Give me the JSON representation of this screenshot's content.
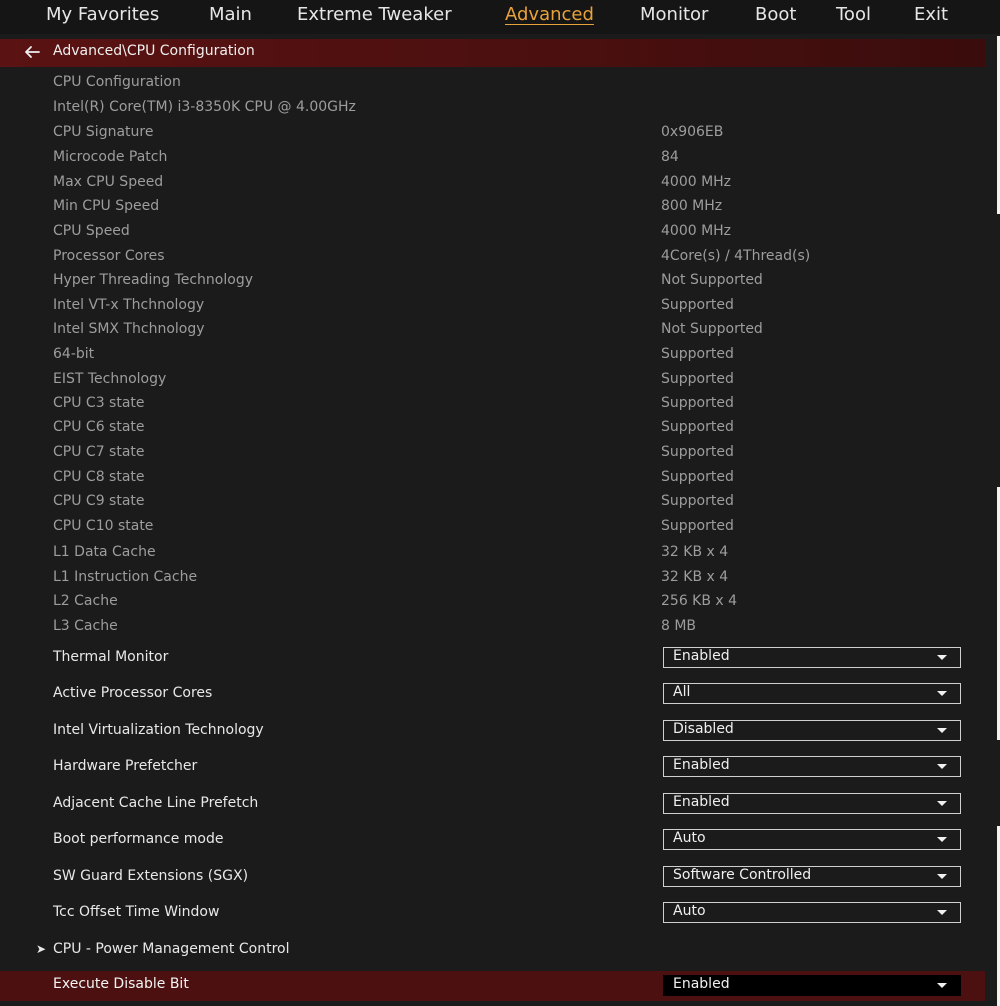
{
  "tabs": [
    {
      "label": "My Favorites"
    },
    {
      "label": "Main"
    },
    {
      "label": "Extreme Tweaker"
    },
    {
      "label": "Advanced"
    },
    {
      "label": "Monitor"
    },
    {
      "label": "Boot"
    },
    {
      "label": "Tool"
    },
    {
      "label": "Exit"
    }
  ],
  "active_tab": "Advanced",
  "breadcrumb": "Advanced\\CPU Configuration",
  "info": {
    "section_title": "CPU Configuration",
    "cpu_name": "Intel(R) Core(TM) i3-8350K CPU @ 4.00GHz",
    "rows": [
      {
        "label": "CPU Signature",
        "value": "0x906EB"
      },
      {
        "label": "Microcode Patch",
        "value": "84"
      },
      {
        "label": "Max CPU Speed",
        "value": "4000 MHz"
      },
      {
        "label": "Min CPU Speed",
        "value": "800 MHz"
      },
      {
        "label": "CPU Speed",
        "value": "4000 MHz"
      },
      {
        "label": "Processor Cores",
        "value": "4Core(s) / 4Thread(s)"
      },
      {
        "label": "Hyper Threading Technology",
        "value": "Not Supported"
      },
      {
        "label": "Intel VT-x Thchnology",
        "value": "Supported"
      },
      {
        "label": "Intel SMX Thchnology",
        "value": "Not Supported"
      },
      {
        "label": "64-bit",
        "value": "Supported"
      },
      {
        "label": "EIST Technology",
        "value": "Supported"
      },
      {
        "label": "CPU C3 state",
        "value": "Supported"
      },
      {
        "label": "CPU C6 state",
        "value": "Supported"
      },
      {
        "label": "CPU C7 state",
        "value": "Supported"
      },
      {
        "label": "CPU C8 state",
        "value": "Supported"
      },
      {
        "label": "CPU C9 state",
        "value": "Supported"
      },
      {
        "label": "CPU C10 state",
        "value": "Supported"
      },
      {
        "label": "L1 Data Cache",
        "value": "32 KB x 4"
      },
      {
        "label": "L1 Instruction Cache",
        "value": "32 KB x 4"
      },
      {
        "label": "L2 Cache",
        "value": "256 KB x 4"
      },
      {
        "label": "L3 Cache",
        "value": "8 MB"
      }
    ]
  },
  "settings": [
    {
      "label": "Thermal Monitor",
      "value": "Enabled"
    },
    {
      "label": "Active Processor Cores",
      "value": "All"
    },
    {
      "label": "Intel Virtualization Technology",
      "value": "Disabled"
    },
    {
      "label": "Hardware Prefetcher",
      "value": "Enabled"
    },
    {
      "label": "Adjacent Cache Line Prefetch",
      "value": "Enabled"
    },
    {
      "label": "Boot performance mode",
      "value": "Auto"
    },
    {
      "label": "SW Guard Extensions (SGX)",
      "value": "Software Controlled"
    },
    {
      "label": "Tcc Offset Time Window",
      "value": "Auto"
    }
  ],
  "submenu": {
    "label": "CPU - Power Management Control"
  },
  "selected_setting": {
    "label": "Execute Disable Bit",
    "value": "Enabled"
  },
  "colors": {
    "active_tab": "#e8a23a",
    "breadcrumb_bar": "#5a1212",
    "selected_row": "#4d1010",
    "background": "#1b1b1b"
  }
}
